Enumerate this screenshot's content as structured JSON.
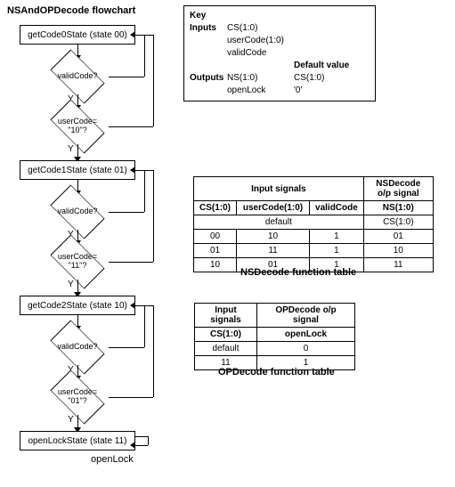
{
  "titles": {
    "flowchart": "NSAndOPDecode flowchart",
    "ns_table": "NSDecode function table",
    "op_table": "OPDecode function table"
  },
  "key": {
    "heading": "Key",
    "inputs_label": "Inputs",
    "inputs": [
      "CS(1:0)",
      "userCode(1:0)",
      "validCode"
    ],
    "outputs_label": "Outputs",
    "outputs": [
      "NS(1:0)",
      "openLock"
    ],
    "default_label": "Default value",
    "defaults": [
      "CS(1:0)",
      "'0'"
    ]
  },
  "states": {
    "s0": "getCode0State (state 00)",
    "s1": "getCode1State (state 01)",
    "s2": "getCode2State (state 10)",
    "s3": "openLockState (state 11)"
  },
  "decisions": {
    "valid": "validCode?",
    "uc10": "userCode=\n\"10\"?",
    "uc11": "userCode=\n\"11\"?",
    "uc01": "userCode=\n\"01\"?"
  },
  "labels": {
    "yes": "Y",
    "output": "openLock"
  },
  "ns_table": {
    "group_input": "Input signals",
    "group_output": "NSDecode o/p signal",
    "headers": [
      "CS(1:0)",
      "userCode(1:0)",
      "validCode",
      "NS(1:0)"
    ],
    "default_row": [
      "default",
      "CS(1:0)"
    ],
    "rows": [
      [
        "00",
        "10",
        "1",
        "01"
      ],
      [
        "01",
        "11",
        "1",
        "10"
      ],
      [
        "10",
        "01",
        "1",
        "11"
      ]
    ]
  },
  "op_table": {
    "group_input": "Input signals",
    "group_output": "OPDecode o/p signal",
    "headers": [
      "CS(1:0)",
      "openLock"
    ],
    "rows": [
      [
        "default",
        "0"
      ],
      [
        "11",
        "1"
      ]
    ]
  }
}
